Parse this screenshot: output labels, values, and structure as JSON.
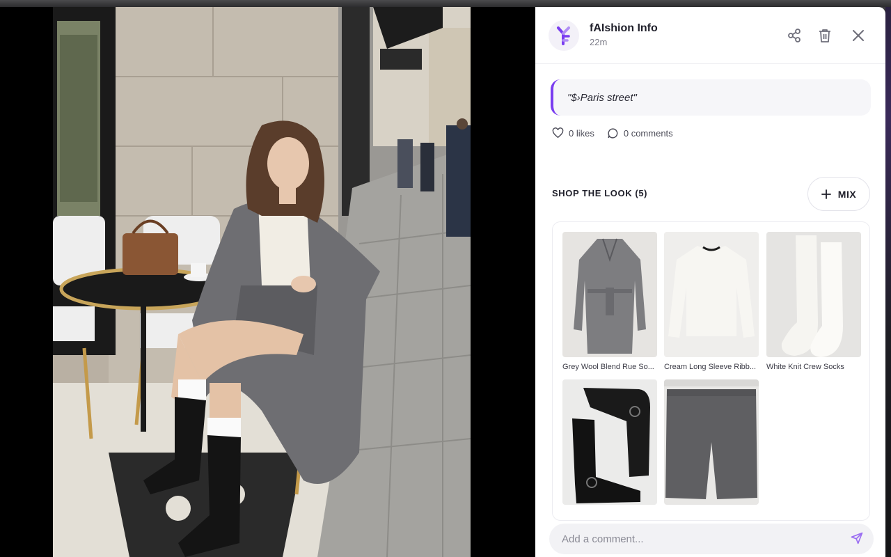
{
  "post": {
    "author": "fAIshion Info",
    "time": "22m",
    "caption": "\"$›Paris street\"",
    "likes": "0 likes",
    "comments": "0 comments"
  },
  "header_icons": [
    "share-icon",
    "trash-icon",
    "close-icon"
  ],
  "shop": {
    "title": "SHOP THE LOOK (5)",
    "mix_label": "MIX",
    "products": [
      {
        "name": "Grey Wool Blend Rue So..."
      },
      {
        "name": "Cream Long Sleeve Ribb..."
      },
      {
        "name": "White Knit Crew Socks"
      },
      {
        "name": ""
      },
      {
        "name": ""
      }
    ]
  },
  "comment": {
    "placeholder": "Add a comment..."
  },
  "colors": {
    "accent": "#7a3df0",
    "brand_logo": "#8e5bf0"
  }
}
